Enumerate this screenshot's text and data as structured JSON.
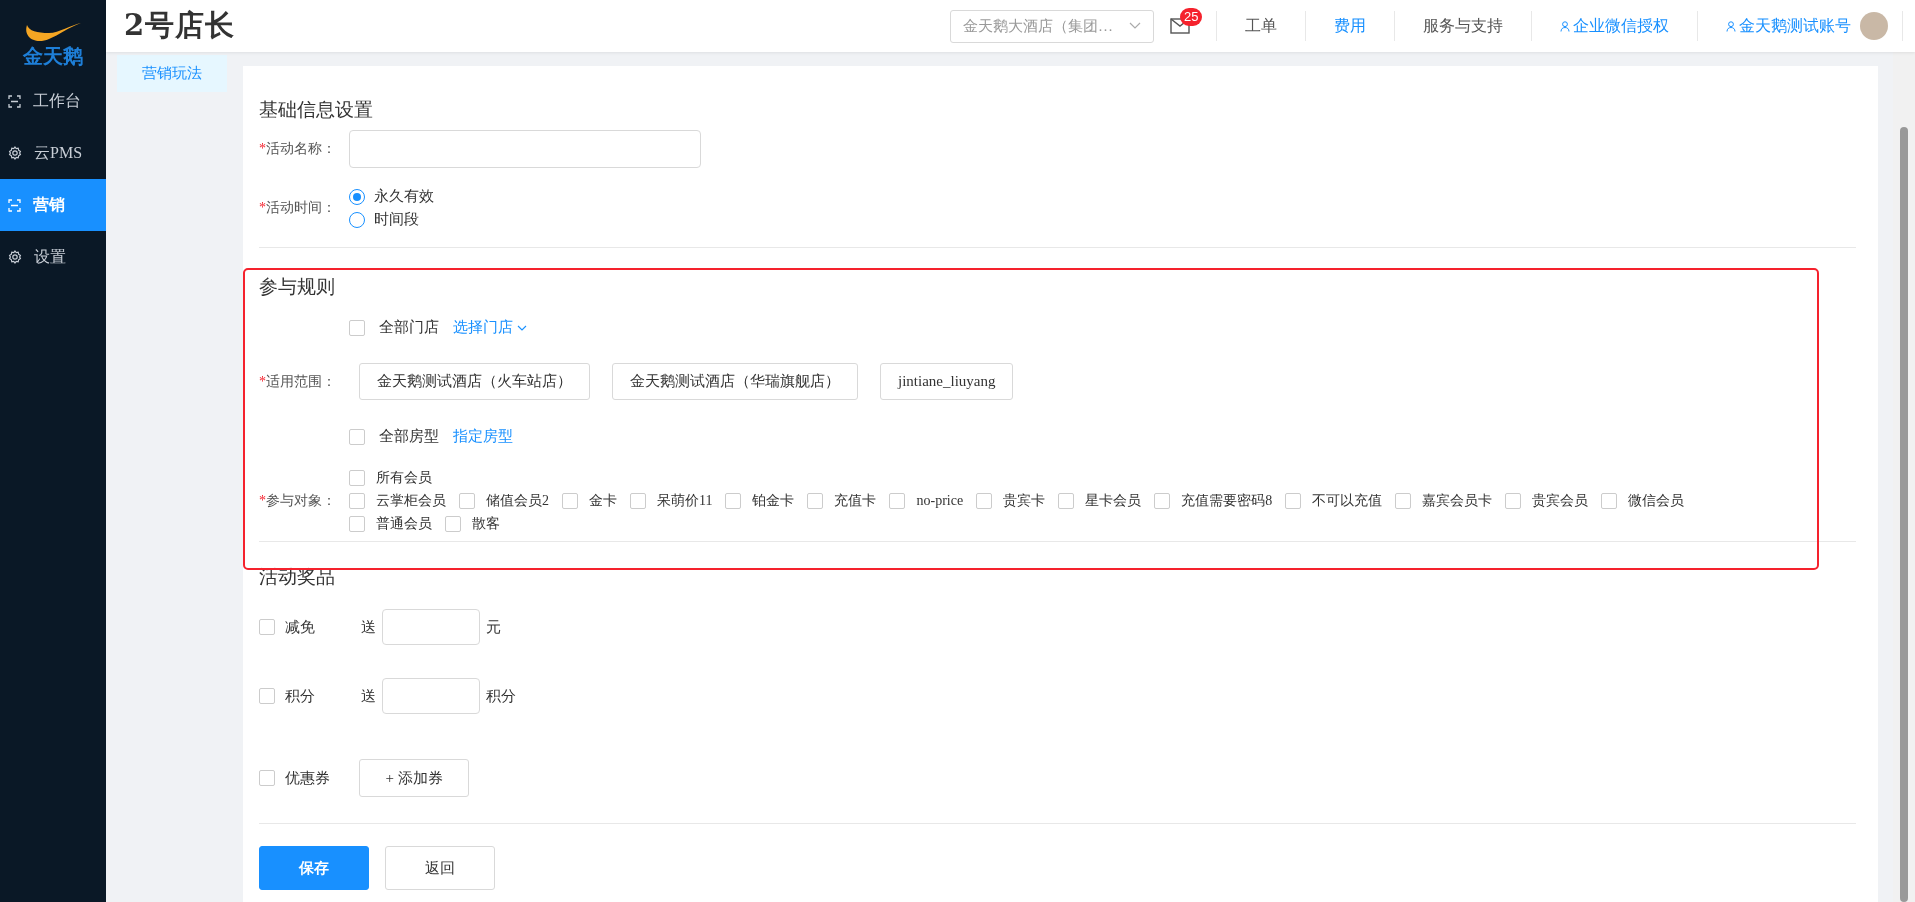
{
  "sidebar": {
    "logo_text": "金天鹅",
    "items": [
      {
        "label": "工作台",
        "kind": "frame",
        "selected": false
      },
      {
        "label": "云PMS",
        "kind": "gear",
        "selected": false
      },
      {
        "label": "营销",
        "kind": "frame",
        "selected": true
      },
      {
        "label": "设置",
        "kind": "gear",
        "selected": false
      }
    ]
  },
  "header": {
    "app_title": "2号店长",
    "hotel_select": "金天鹅大酒店（集团…",
    "mail_badge": "25",
    "nav": [
      {
        "label": "工单",
        "kind": "text"
      },
      {
        "label": "费用",
        "kind": "link"
      },
      {
        "label": "服务与支持",
        "kind": "text"
      },
      {
        "label": "企业微信授权",
        "kind": "user"
      },
      {
        "label": "金天鹅测试账号",
        "kind": "user"
      }
    ]
  },
  "subnav": [
    {
      "label": "营销玩法",
      "selected": true
    }
  ],
  "basic": {
    "title": "基础信息设置",
    "name": {
      "mark": "*",
      "label": "活动名称："
    },
    "time": {
      "mark": "*",
      "label": "活动时间：",
      "options": [
        {
          "label": "永久有效",
          "selected": true
        },
        {
          "label": "时间段",
          "selected": false
        }
      ]
    }
  },
  "rules": {
    "title": "参与规则",
    "all_stores": {
      "label": "全部门店",
      "checked": false
    },
    "store_link": "选择门店",
    "scope": {
      "mark": "*",
      "label": "适用范围：",
      "stores": [
        "金天鹅测试酒店（火车站店）",
        "金天鹅测试酒店（华瑞旗舰店）",
        "jintiane_liuyang"
      ]
    },
    "all_rooms": {
      "label": "全部房型",
      "checked": false
    },
    "room_link": "指定房型",
    "target": {
      "mark": "*",
      "label": "参与对象：",
      "lines": [
        {
          "items": [
            {
              "label": "所有会员",
              "checked": false
            }
          ]
        },
        {
          "items": [
            {
              "label": "云掌柜会员",
              "checked": false
            },
            {
              "label": "储值会员2",
              "checked": false
            },
            {
              "label": "金卡",
              "checked": false
            },
            {
              "label": "呆萌价11",
              "checked": false
            },
            {
              "label": "铂金卡",
              "checked": false
            },
            {
              "label": "充值卡",
              "checked": false
            },
            {
              "label": "no-price",
              "checked": false
            },
            {
              "label": "贵宾卡",
              "checked": false
            },
            {
              "label": "星卡会员",
              "checked": false
            },
            {
              "label": "充值需要密码8",
              "checked": false
            },
            {
              "label": "不可以充值",
              "checked": false
            },
            {
              "label": "嘉宾会员卡",
              "checked": false
            },
            {
              "label": "贵宾会员",
              "checked": false
            },
            {
              "label": "微信会员",
              "checked": false
            }
          ]
        },
        {
          "items": [
            {
              "label": "普通会员",
              "checked": false
            },
            {
              "label": "散客",
              "checked": false
            }
          ]
        }
      ]
    }
  },
  "prizes": {
    "title": "活动奖品",
    "items": [
      {
        "kind": "amount",
        "label": "减免",
        "checked": false,
        "prefix": "送",
        "unit": "元"
      },
      {
        "kind": "amount",
        "label": "积分",
        "checked": false,
        "prefix": "送",
        "unit": "积分"
      },
      {
        "kind": "coupon",
        "label": "优惠券",
        "checked": false,
        "button": "+ 添加券"
      }
    ]
  },
  "buttons": [
    {
      "label": "保存",
      "kind": "primary"
    },
    {
      "label": "返回",
      "kind": "default"
    }
  ]
}
